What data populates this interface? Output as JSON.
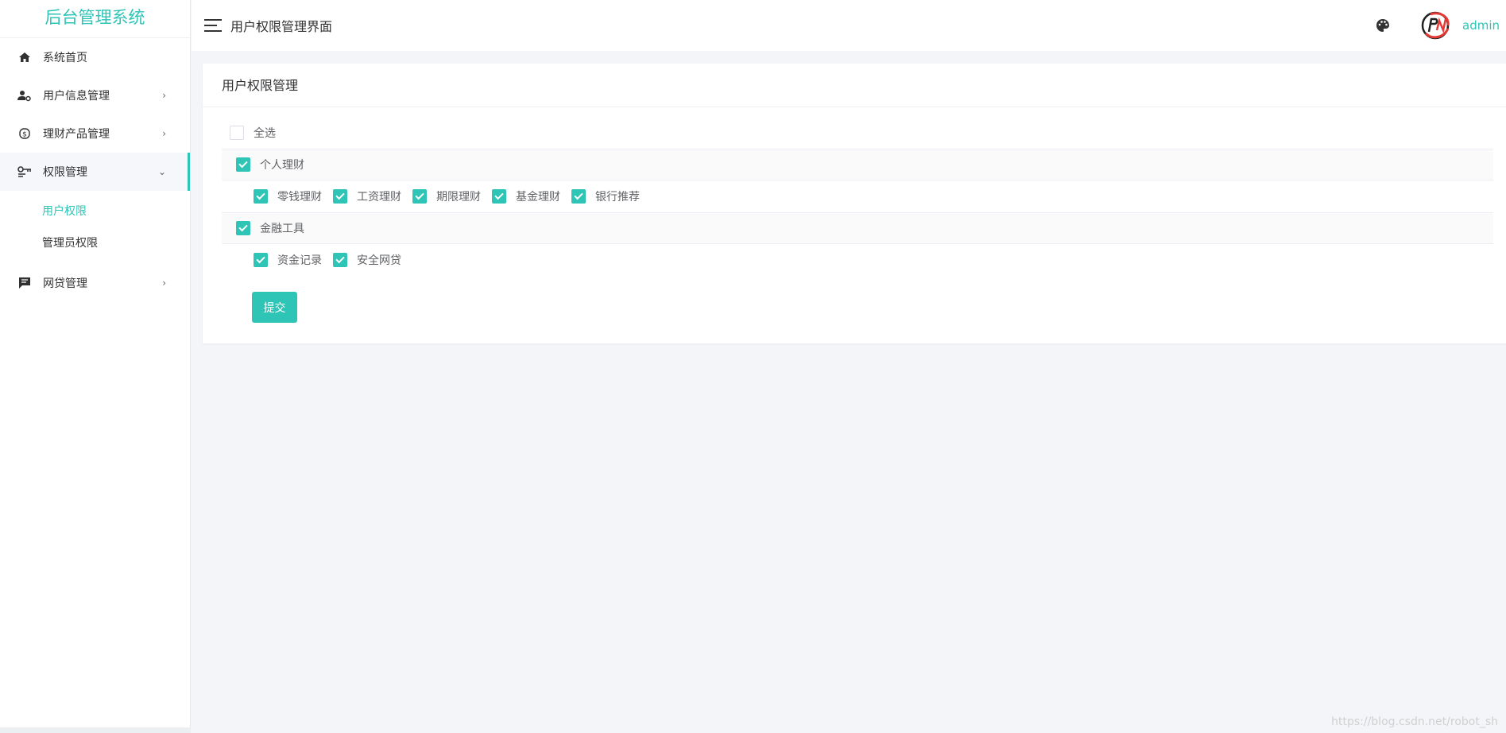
{
  "app": {
    "brand": "后台管理系统",
    "header_title": "用户权限管理界面",
    "username": "admin"
  },
  "sidebar": {
    "items": [
      {
        "label": "系统首页",
        "icon": "home-icon",
        "arrow": ""
      },
      {
        "label": "用户信息管理",
        "icon": "user-settings-icon",
        "arrow": "›"
      },
      {
        "label": "理财产品管理",
        "icon": "finance-icon",
        "arrow": "›"
      },
      {
        "label": "权限管理",
        "icon": "key-icon",
        "arrow": "⌄"
      },
      {
        "label": "网贷管理",
        "icon": "message-icon",
        "arrow": "›"
      }
    ],
    "submenu": [
      {
        "label": "用户权限"
      },
      {
        "label": "管理员权限"
      }
    ]
  },
  "card": {
    "title": "用户权限管理",
    "select_all": "全选",
    "groups": [
      {
        "label": "个人理财",
        "children": [
          "零钱理财",
          "工资理财",
          "期限理财",
          "基金理财",
          "银行推荐"
        ]
      },
      {
        "label": "金融工具",
        "children": [
          "资金记录",
          "安全网贷"
        ]
      }
    ],
    "submit": "提交"
  },
  "watermark": "https://blog.csdn.net/robot_sh",
  "colors": {
    "accent": "#2ec4b6"
  }
}
